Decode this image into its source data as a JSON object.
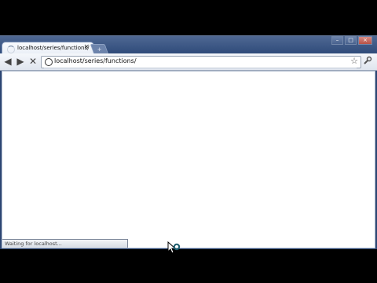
{
  "browser": {
    "tab": {
      "title": "localhost/series/functions/",
      "close_glyph": "×"
    },
    "newtab_glyph": "+",
    "window_controls": {
      "minimize": "–",
      "maximize": "□",
      "close": "×"
    },
    "toolbar": {
      "back_glyph": "◀",
      "forward_glyph": "▶",
      "stop_glyph": "✕",
      "url": "localhost/series/functions/",
      "star_glyph": "☆",
      "wrench_glyph": "🔧"
    },
    "status_text": "Waiting for localhost..."
  },
  "colors": {
    "frame": "#2d4673",
    "page": "#ffffff"
  },
  "icons": [
    "tab-loading-spinner-icon",
    "globe-icon",
    "star-icon",
    "wrench-icon",
    "busy-cursor-icon"
  ]
}
